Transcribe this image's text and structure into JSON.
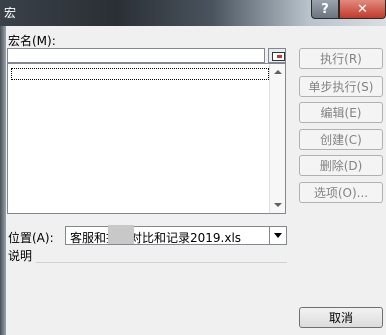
{
  "window": {
    "title": "宏",
    "help_label": "?",
    "close_label": "✕"
  },
  "labels": {
    "macro_name": "宏名(M):",
    "location": "位置(A):",
    "description": "说明"
  },
  "macro_name_value": "",
  "macro_list": [],
  "location_value": "客服和投诉对比和记录2019.xls",
  "buttons": {
    "run": "执行(R)",
    "step_into": "单步执行(S)",
    "edit": "编辑(E)",
    "create": "创建(C)",
    "delete": "删除(D)",
    "options": "选项(O)...",
    "cancel": "取消"
  },
  "icons": {
    "picker": "cell-picker-icon",
    "dropdown": "chevron-down-icon",
    "scroll_up": "scroll-up-icon",
    "scroll_down": "scroll-down-icon"
  }
}
